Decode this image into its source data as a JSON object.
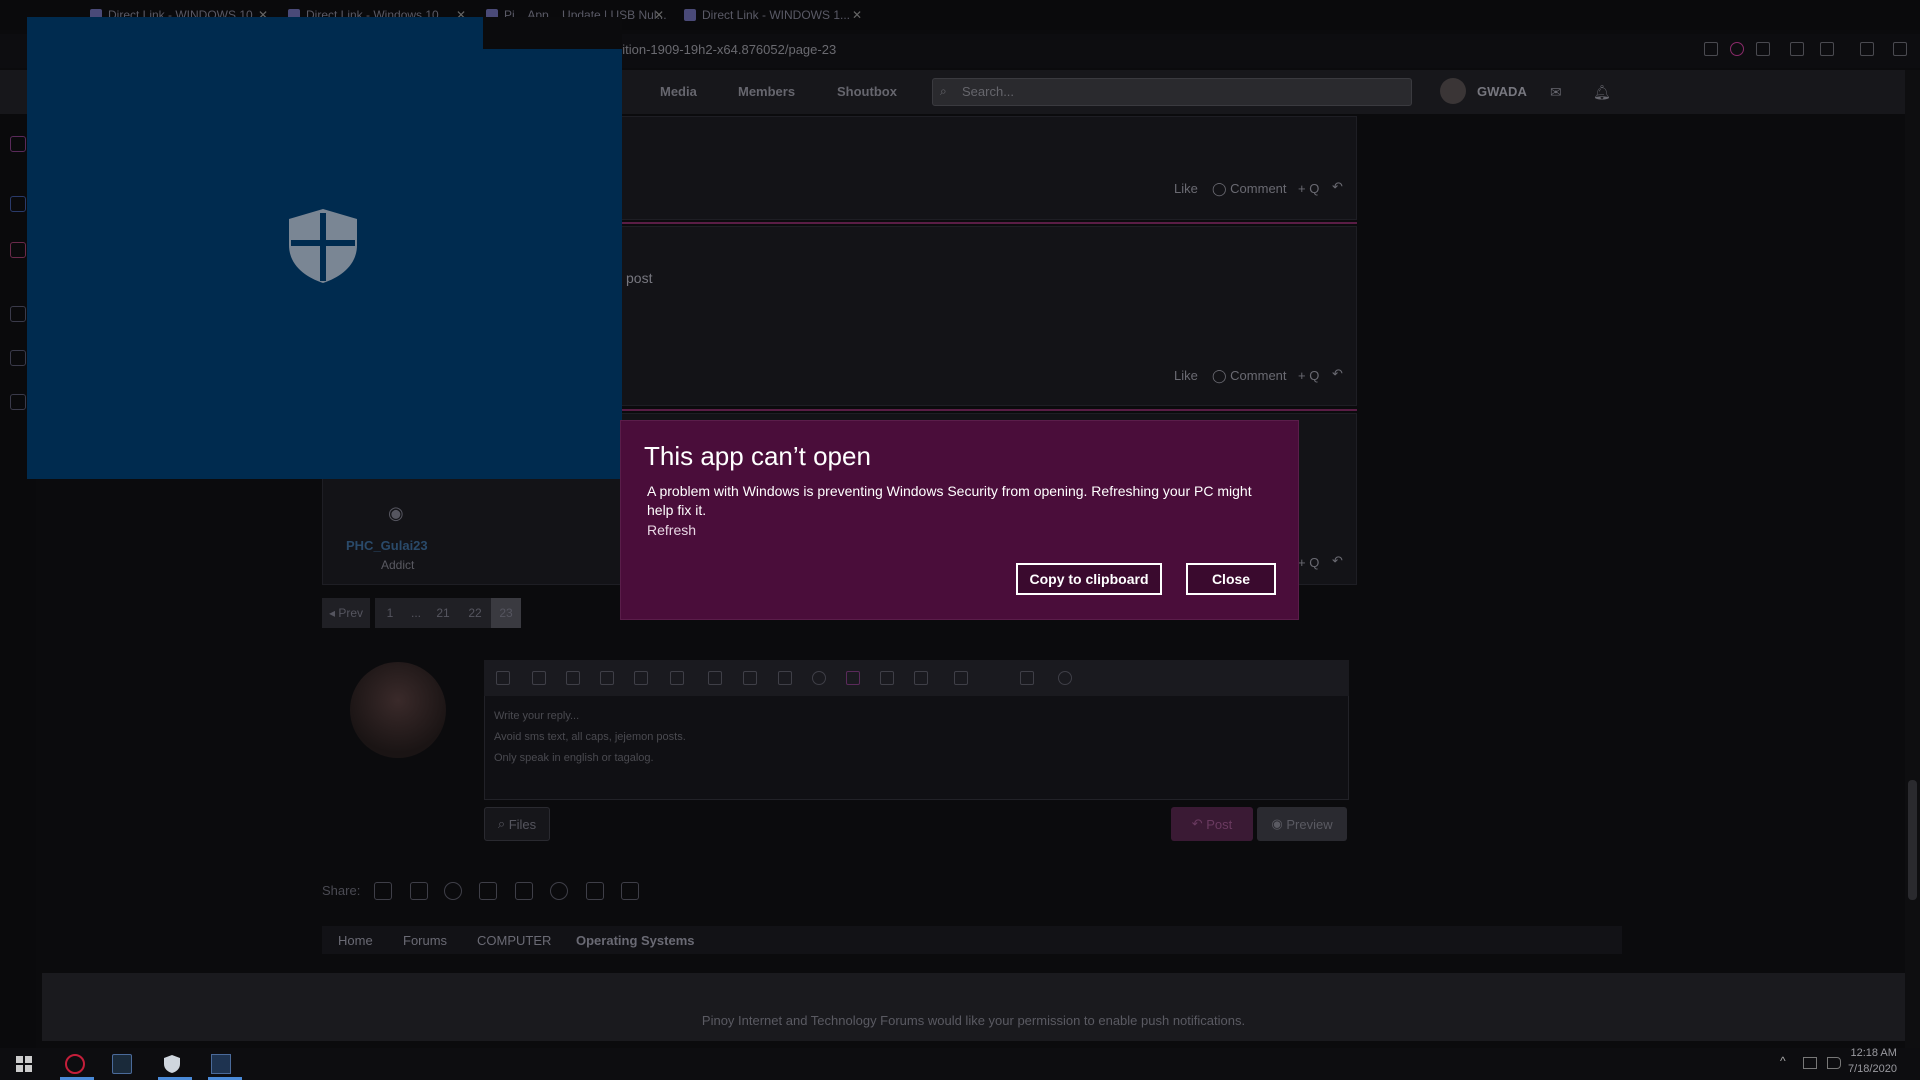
{
  "browser": {
    "tabs": [
      {
        "title": "Direct Link - WINDOWS 10..."
      },
      {
        "title": "Direct Link - Windows 10 ..."
      },
      {
        "title": "Pi... App... Update | USB Nul..."
      },
      {
        "title": "Direct Link - WINDOWS 1..."
      }
    ],
    "url_visible": "dition-1909-19h2-x64.876052/page-23"
  },
  "site": {
    "nav": {
      "media": "Media",
      "members": "Members",
      "shoutbox": "Shoutbox"
    },
    "search_placeholder": "Search...",
    "username": "GWADA"
  },
  "posts": [
    {
      "like": "Like",
      "comment": "Comment",
      "quote": "+ Q"
    },
    {
      "text": "post",
      "like": "Like",
      "comment": "Comment",
      "quote": "+ Q"
    },
    {
      "author": "PHC_Gulai23",
      "role": "Addict",
      "quote": "+ Q"
    }
  ],
  "pagination": {
    "prev": "◂ Prev",
    "pages": [
      "1",
      "...",
      "21",
      "22",
      "23"
    ]
  },
  "editor": {
    "lines": [
      "Write your reply...",
      "Avoid sms text, all caps, jejemon posts.",
      "Only speak in english or tagalog."
    ],
    "files_label": "Files",
    "post_label": "Post",
    "preview_label": "Preview"
  },
  "share": {
    "label": "Share:"
  },
  "breadcrumb": [
    "Home",
    "Forums",
    "COMPUTER",
    "Operating Systems"
  ],
  "footer": {
    "notice": "Pinoy Internet and Technology Forums would like your permission to enable push notifications."
  },
  "dialog": {
    "title": "This app can’t open",
    "message": "A problem with Windows is preventing Windows Security from opening. Refreshing your PC might help fix it.",
    "link": "Refresh",
    "copy_label": "Copy to clipboard",
    "close_label": "Close"
  },
  "taskbar": {
    "time": "12:18 AM",
    "date": "7/18/2020"
  },
  "colors": {
    "dialog_bg": "#4a0d3a",
    "splash_bg": "#002b4f",
    "accent": "#5a1d45"
  }
}
